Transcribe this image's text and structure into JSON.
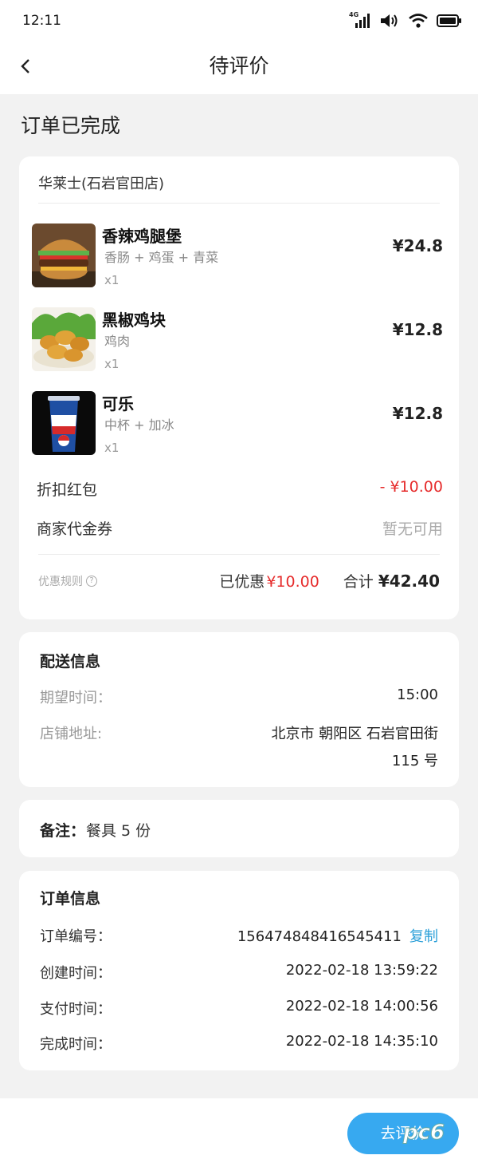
{
  "status": {
    "time": "12:11",
    "network": "4G"
  },
  "nav": {
    "title": "待评价"
  },
  "heading": "订单已完成",
  "order": {
    "shop": "华莱士(石岩官田店)",
    "items": [
      {
        "name": "香辣鸡腿堡",
        "spec": "香肠 + 鸡蛋 + 青菜",
        "qty": "x1",
        "price": "¥24.8"
      },
      {
        "name": "黑椒鸡块",
        "spec": "鸡肉",
        "qty": "x1",
        "price": "¥12.8"
      },
      {
        "name": "可乐",
        "spec": "中杯 + 加冰",
        "qty": "x1",
        "price": "¥12.8"
      }
    ],
    "discount_label": "折扣红包",
    "discount_value": "- ¥10.00",
    "voucher_label": "商家代金券",
    "voucher_value": "暂无可用",
    "rules_label": "优惠规则",
    "saved_label": "已优惠",
    "saved_value": "¥10.00",
    "total_label": "合计",
    "total_value": "¥42.40"
  },
  "delivery": {
    "title": "配送信息",
    "time_label": "期望时间：",
    "time_value": "15:00",
    "addr_label": "店铺地址:",
    "addr_line1": "北京市 朝阳区 石岩官田街",
    "addr_line2": "115 号"
  },
  "note": {
    "label": "备注：",
    "value": "餐具 5 份"
  },
  "info": {
    "title": "订单信息",
    "order_no_label": "订单编号：",
    "order_no": "156474848416545411",
    "copy_label": "复制",
    "created_label": "创建时间：",
    "created": "2022-02-18 13:59:22",
    "paid_label": "支付时间：",
    "paid": "2022-02-18 14:00:56",
    "done_label": "完成时间：",
    "done": "2022-02-18 14:35:10"
  },
  "action": {
    "review_label": "去评价"
  },
  "watermark": "pc6"
}
